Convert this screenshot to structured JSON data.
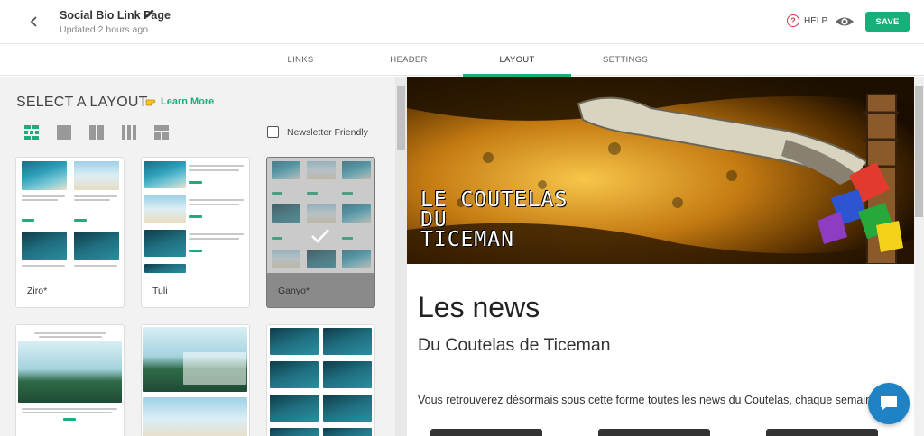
{
  "header": {
    "title": "Social Bio Link Page",
    "updated": "Updated 2 hours ago",
    "help_label": "HELP",
    "save_label": "SAVE"
  },
  "tabs": [
    {
      "label": "LINKS"
    },
    {
      "label": "HEADER"
    },
    {
      "label": "LAYOUT",
      "active": true
    },
    {
      "label": "SETTINGS"
    }
  ],
  "layout_panel": {
    "title": "SELECT A LAYOUT",
    "learn_more": "Learn More",
    "newsletter_label": "Newsletter Friendly",
    "newsletter_checked": false,
    "view_modes": [
      "grid-view-icon",
      "single-column-icon",
      "two-column-icon",
      "three-column-icon",
      "mixed-layout-icon"
    ],
    "layouts": [
      {
        "name": "Ziro*"
      },
      {
        "name": "Tuli"
      },
      {
        "name": "Ganyo*",
        "selected": true
      },
      {
        "name": ""
      },
      {
        "name": ""
      },
      {
        "name": ""
      }
    ]
  },
  "preview": {
    "hero_text": "LE COUTELAS\nDU\nTICEMAN",
    "heading": "Les news",
    "subheading": "Du Coutelas de Ticeman",
    "body": "Vous retrouverez désormais sous cette forme toutes les news du Coutelas, chaque semaine."
  },
  "colors": {
    "accent": "#17b07b",
    "help": "#e0344e",
    "chat": "#1e82c4"
  }
}
